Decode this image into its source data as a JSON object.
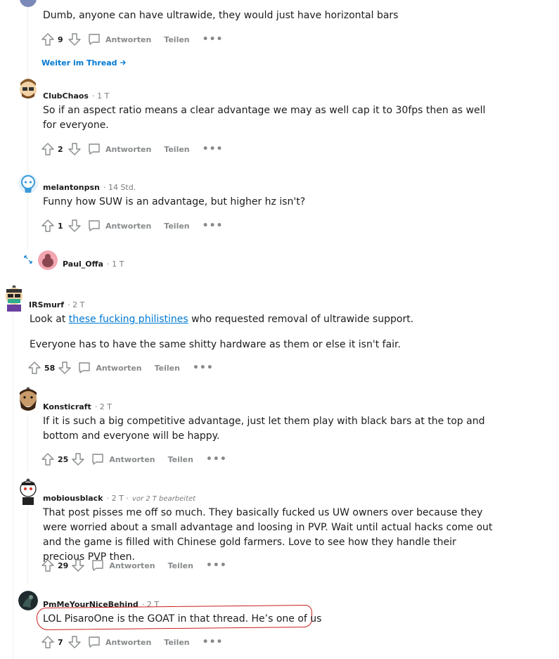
{
  "comments": [
    {
      "id": "c0",
      "text": "Dumb, anyone can have ultrawide, they would just have horizontal bars",
      "votes": "9"
    },
    {
      "id": "c1",
      "author": "ClubChaos",
      "time": "· 1 T",
      "text": "So if an aspect ratio means a clear advantage we may as well cap it to 30fps then as well for everyone.",
      "votes": "2"
    },
    {
      "id": "c2",
      "author": "melantonpsn",
      "time": "· 14 Std.",
      "text": "Funny how SUW is an advantage, but higher hz isn't?",
      "votes": "1"
    },
    {
      "id": "c3",
      "author": "Paul_Offa",
      "time": "· 1 T"
    },
    {
      "id": "c4",
      "author": "IRSmurf",
      "time": "· 2 T",
      "text_before_link": "Look at ",
      "link_text": "these fucking philistines",
      "text_after_link": " who requested removal of ultrawide support.",
      "text2": "Everyone has to have the same shitty hardware as them or else it isn't fair.",
      "votes": "58"
    },
    {
      "id": "c5",
      "author": "Konsticraft",
      "time": "· 2 T",
      "text": "If it is such a big competitive advantage, just let them play with black bars at the top and bottom and everyone will be happy.",
      "votes": "25"
    },
    {
      "id": "c6",
      "author": "mobiousblack",
      "time": "· 2 T ·",
      "edited": "vor 2 T bearbeitet",
      "text": "That post pisses me off so much. They basically fucked us UW owners over because they were worried about a small advantage and loosing in PVP. Wait until actual hacks come out and the game is filled with Chinese gold farmers. Love to see how they handle their precious PVP then.",
      "votes": "29"
    },
    {
      "id": "c7",
      "author": "PmMeYourNiceBehind",
      "time": "· 2 T",
      "text": "LOL PisaroOne is the GOAT in that thread. He’s one of us",
      "votes": "7"
    }
  ],
  "labels": {
    "reply": "Antworten",
    "share": "Teilen",
    "more": "•••",
    "continue_thread": "Weiter im Thread"
  },
  "icons": {
    "upvote": "arrow-up-icon",
    "downvote": "arrow-down-icon",
    "reply": "speech-bubble-icon",
    "more": "more-dots-icon",
    "expand": "expand-diagonal-icon",
    "continue": "arrow-right-icon"
  },
  "colors": {
    "link": "#0079d3",
    "muted": "#878a8c",
    "highlight_ring": "#cc1f1f"
  }
}
